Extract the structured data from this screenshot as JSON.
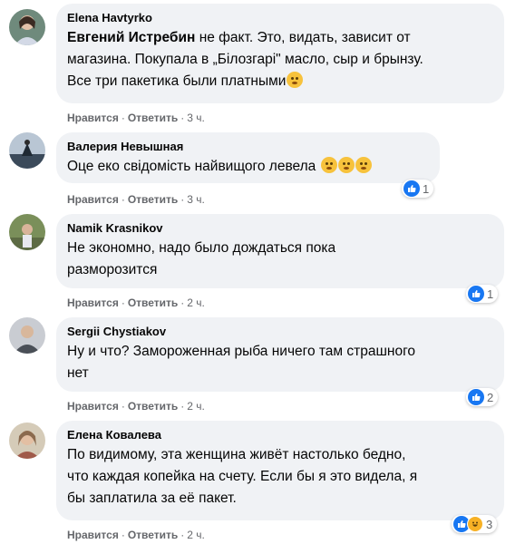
{
  "comments": [
    {
      "author": "Elena Havtyrko",
      "mention": "Евгений Истребин",
      "text_lines": [
        "не факт. Это, видать, зависит от",
        "магазина. Покупала в „Білозгарі\" масло, сыр и брынзу.",
        "Все три пакетика были платными"
      ],
      "like": "Нравится",
      "reply": "Ответить",
      "time": "3 ч.",
      "reaction_count": null
    },
    {
      "author": "Валерия Невышная",
      "text_lines": [
        "Оце еко свідомість найвищого левела"
      ],
      "like": "Нравится",
      "reply": "Ответить",
      "time": "3 ч.",
      "reaction_count": "1"
    },
    {
      "author": "Namik Krasnikov",
      "text_lines": [
        "Не экономно, надо было дождаться пока",
        "разморозится"
      ],
      "like": "Нравится",
      "reply": "Ответить",
      "time": "2 ч.",
      "reaction_count": "1"
    },
    {
      "author": "Sergii Chystiakov",
      "text_lines": [
        "Ну и что? Замороженная рыба ничего там страшного",
        "нет"
      ],
      "like": "Нравится",
      "reply": "Ответить",
      "time": "2 ч.",
      "reaction_count": "2"
    },
    {
      "author": "Елена Ковалева",
      "text_lines": [
        "По видимому, эта женщина живёт настолько бедно,",
        "что каждая копейка на счету. Если бы я это видела, я",
        "бы заплатила за её пакет."
      ],
      "like": "Нравится",
      "reply": "Ответить",
      "time": "2 ч.",
      "reaction_count": "3"
    }
  ],
  "separator": "·",
  "colors": {
    "bubble": "#f0f2f5",
    "meta": "#65676b",
    "like_blue": "#1877f2",
    "emoji_yellow": "#f7c23c"
  }
}
